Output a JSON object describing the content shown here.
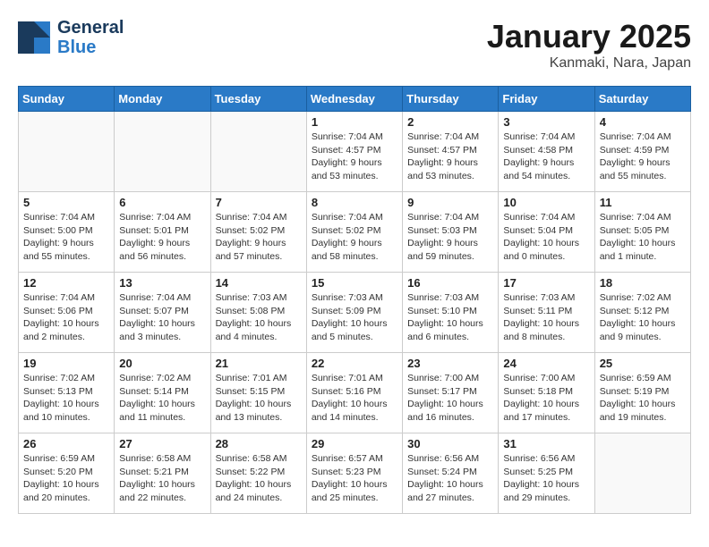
{
  "logo": {
    "general": "General",
    "blue": "Blue"
  },
  "title": "January 2025",
  "subtitle": "Kanmaki, Nara, Japan",
  "weekdays": [
    "Sunday",
    "Monday",
    "Tuesday",
    "Wednesday",
    "Thursday",
    "Friday",
    "Saturday"
  ],
  "weeks": [
    [
      {
        "day": "",
        "info": ""
      },
      {
        "day": "",
        "info": ""
      },
      {
        "day": "",
        "info": ""
      },
      {
        "day": "1",
        "info": "Sunrise: 7:04 AM\nSunset: 4:57 PM\nDaylight: 9 hours\nand 53 minutes."
      },
      {
        "day": "2",
        "info": "Sunrise: 7:04 AM\nSunset: 4:57 PM\nDaylight: 9 hours\nand 53 minutes."
      },
      {
        "day": "3",
        "info": "Sunrise: 7:04 AM\nSunset: 4:58 PM\nDaylight: 9 hours\nand 54 minutes."
      },
      {
        "day": "4",
        "info": "Sunrise: 7:04 AM\nSunset: 4:59 PM\nDaylight: 9 hours\nand 55 minutes."
      }
    ],
    [
      {
        "day": "5",
        "info": "Sunrise: 7:04 AM\nSunset: 5:00 PM\nDaylight: 9 hours\nand 55 minutes."
      },
      {
        "day": "6",
        "info": "Sunrise: 7:04 AM\nSunset: 5:01 PM\nDaylight: 9 hours\nand 56 minutes."
      },
      {
        "day": "7",
        "info": "Sunrise: 7:04 AM\nSunset: 5:02 PM\nDaylight: 9 hours\nand 57 minutes."
      },
      {
        "day": "8",
        "info": "Sunrise: 7:04 AM\nSunset: 5:02 PM\nDaylight: 9 hours\nand 58 minutes."
      },
      {
        "day": "9",
        "info": "Sunrise: 7:04 AM\nSunset: 5:03 PM\nDaylight: 9 hours\nand 59 minutes."
      },
      {
        "day": "10",
        "info": "Sunrise: 7:04 AM\nSunset: 5:04 PM\nDaylight: 10 hours\nand 0 minutes."
      },
      {
        "day": "11",
        "info": "Sunrise: 7:04 AM\nSunset: 5:05 PM\nDaylight: 10 hours\nand 1 minute."
      }
    ],
    [
      {
        "day": "12",
        "info": "Sunrise: 7:04 AM\nSunset: 5:06 PM\nDaylight: 10 hours\nand 2 minutes."
      },
      {
        "day": "13",
        "info": "Sunrise: 7:04 AM\nSunset: 5:07 PM\nDaylight: 10 hours\nand 3 minutes."
      },
      {
        "day": "14",
        "info": "Sunrise: 7:03 AM\nSunset: 5:08 PM\nDaylight: 10 hours\nand 4 minutes."
      },
      {
        "day": "15",
        "info": "Sunrise: 7:03 AM\nSunset: 5:09 PM\nDaylight: 10 hours\nand 5 minutes."
      },
      {
        "day": "16",
        "info": "Sunrise: 7:03 AM\nSunset: 5:10 PM\nDaylight: 10 hours\nand 6 minutes."
      },
      {
        "day": "17",
        "info": "Sunrise: 7:03 AM\nSunset: 5:11 PM\nDaylight: 10 hours\nand 8 minutes."
      },
      {
        "day": "18",
        "info": "Sunrise: 7:02 AM\nSunset: 5:12 PM\nDaylight: 10 hours\nand 9 minutes."
      }
    ],
    [
      {
        "day": "19",
        "info": "Sunrise: 7:02 AM\nSunset: 5:13 PM\nDaylight: 10 hours\nand 10 minutes."
      },
      {
        "day": "20",
        "info": "Sunrise: 7:02 AM\nSunset: 5:14 PM\nDaylight: 10 hours\nand 11 minutes."
      },
      {
        "day": "21",
        "info": "Sunrise: 7:01 AM\nSunset: 5:15 PM\nDaylight: 10 hours\nand 13 minutes."
      },
      {
        "day": "22",
        "info": "Sunrise: 7:01 AM\nSunset: 5:16 PM\nDaylight: 10 hours\nand 14 minutes."
      },
      {
        "day": "23",
        "info": "Sunrise: 7:00 AM\nSunset: 5:17 PM\nDaylight: 10 hours\nand 16 minutes."
      },
      {
        "day": "24",
        "info": "Sunrise: 7:00 AM\nSunset: 5:18 PM\nDaylight: 10 hours\nand 17 minutes."
      },
      {
        "day": "25",
        "info": "Sunrise: 6:59 AM\nSunset: 5:19 PM\nDaylight: 10 hours\nand 19 minutes."
      }
    ],
    [
      {
        "day": "26",
        "info": "Sunrise: 6:59 AM\nSunset: 5:20 PM\nDaylight: 10 hours\nand 20 minutes."
      },
      {
        "day": "27",
        "info": "Sunrise: 6:58 AM\nSunset: 5:21 PM\nDaylight: 10 hours\nand 22 minutes."
      },
      {
        "day": "28",
        "info": "Sunrise: 6:58 AM\nSunset: 5:22 PM\nDaylight: 10 hours\nand 24 minutes."
      },
      {
        "day": "29",
        "info": "Sunrise: 6:57 AM\nSunset: 5:23 PM\nDaylight: 10 hours\nand 25 minutes."
      },
      {
        "day": "30",
        "info": "Sunrise: 6:56 AM\nSunset: 5:24 PM\nDaylight: 10 hours\nand 27 minutes."
      },
      {
        "day": "31",
        "info": "Sunrise: 6:56 AM\nSunset: 5:25 PM\nDaylight: 10 hours\nand 29 minutes."
      },
      {
        "day": "",
        "info": ""
      }
    ]
  ]
}
